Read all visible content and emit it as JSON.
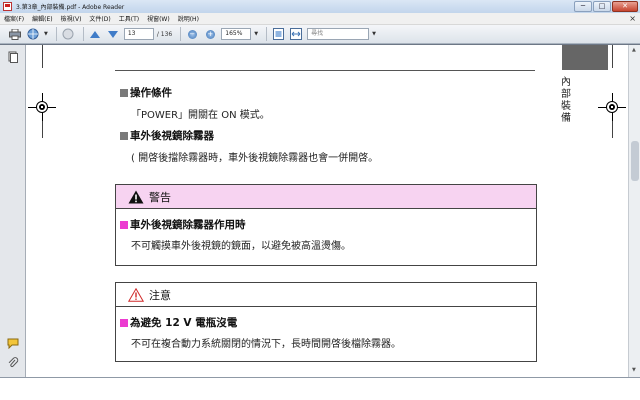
{
  "window": {
    "title": "3.第3章_內部裝備.pdf - Adobe Reader",
    "controls": [
      "─",
      "□",
      "✕"
    ]
  },
  "menu": {
    "items": [
      "檔案(F)",
      "編輯(E)",
      "檢視(V)",
      "文件(D)",
      "工具(T)",
      "視窗(W)",
      "說明(H)"
    ],
    "close": "×"
  },
  "toolbar": {
    "page_current": "13",
    "page_total": "/ 136",
    "zoom": "165%",
    "search_placeholder": "尋找"
  },
  "page": {
    "side_tab_text": "內部裝備",
    "sec1_heading": "操作條件",
    "sec1_body": "「POWER」開關在 ON 模式。",
    "sec2_heading": "車外後視鏡除霧器",
    "sec2_body": "( 開啓後擋除霧器時，車外後視鏡除霧器也會一併開啓。",
    "warning": {
      "label": "警告",
      "sub": "車外後視鏡除霧器作用時",
      "body": "不可觸摸車外後視鏡的鏡面，以避免被高溫燙傷。"
    },
    "caution": {
      "label": "注意",
      "sub": "為避免 12 V 電瓶沒電",
      "body": "不可在複合動力系統關閉的情況下，長時間開啓後檔除霧器。"
    }
  },
  "colors": {
    "warning_bg": "#f7d3f1",
    "pink_square": "#ec3bd0",
    "gray_square": "#7a7a7a"
  }
}
